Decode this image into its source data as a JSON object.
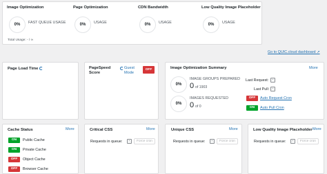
{
  "top": {
    "sections": [
      {
        "title": "Image Optimization",
        "percent": "0%",
        "label": "FAST QUEUE USAGE"
      },
      {
        "title": "Page Optimization",
        "percent": "0%",
        "label": "USAGE"
      },
      {
        "title": "CDN Bandwidth",
        "percent": "0%",
        "label": "USAGE"
      },
      {
        "title": "Low Quality Image Placeholder",
        "percent": "0%",
        "label": "USAGE"
      }
    ],
    "total_usage": "Total Usage: - / ∞"
  },
  "dashboard_link": "Go to QUIC.cloud dashboard",
  "page_load": {
    "title": "Page Load Time"
  },
  "pagespeed": {
    "title_line1": "PageSpeed",
    "title_line2": "Score",
    "guest_mode_line1": "Guest",
    "guest_mode_line2": "Mode",
    "toggle": "OFF"
  },
  "img_summary": {
    "title": "Image Optimization Summary",
    "more": "More",
    "ring1": {
      "percent": "0%",
      "label": "IMAGE GROUPS PREPARED",
      "value": "0",
      "of": "of 1903"
    },
    "ring2": {
      "percent": "0%",
      "label": "IMAGES REQUESTED",
      "value": "0",
      "of": "of 0"
    },
    "last_request_label": "Last Request:",
    "last_pull_label": "Last Pull:",
    "dash": "-",
    "auto_request": {
      "state": "OFF",
      "label": "Auto Request Cron"
    },
    "auto_pull": {
      "state": "ON",
      "label": "Auto Pull Cron"
    }
  },
  "cache": {
    "title": "Cache Status",
    "more": "More",
    "items": [
      {
        "state": "ON",
        "label": "Public Cache"
      },
      {
        "state": "ON",
        "label": "Private Cache"
      },
      {
        "state": "OFF",
        "label": "Object Cache"
      },
      {
        "state": "OFF",
        "label": "Browser Cache"
      }
    ]
  },
  "critical_css": {
    "title": "Critical CSS",
    "more": "More",
    "queue_label": "Requests in queue:",
    "dash": "-",
    "button": "Force cron"
  },
  "unique_css": {
    "title": "Unique CSS",
    "more": "More",
    "queue_label": "Requests in queue:",
    "dash": "-",
    "button": "Force cron"
  },
  "lqip": {
    "title": "Low Quality Image Placeholder",
    "more": "More",
    "queue_label": "Requests in queue:",
    "dash": "-",
    "button": "Force cron"
  },
  "colors": {
    "on": "#00a32a",
    "off": "#d63638",
    "link": "#2271b1"
  }
}
